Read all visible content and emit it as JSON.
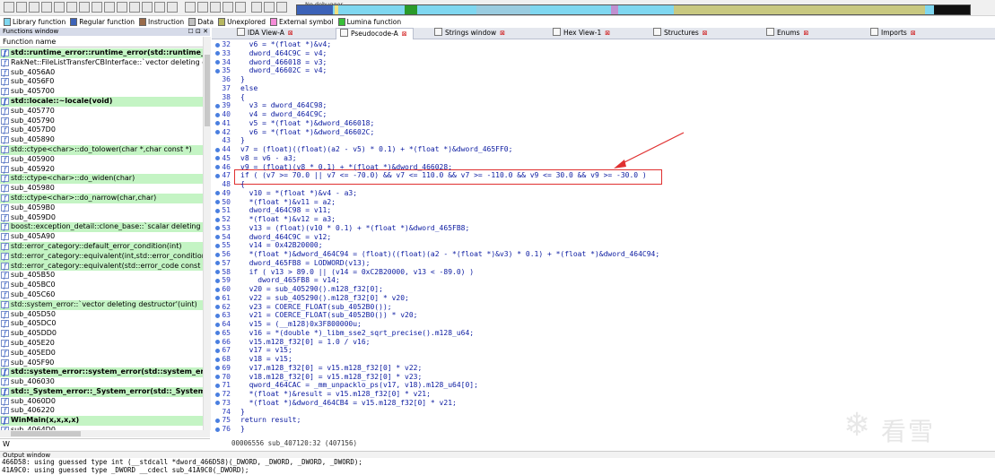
{
  "legend": [
    {
      "label": "Library function",
      "color": "#7fd7f0"
    },
    {
      "label": "Regular function",
      "color": "#3c62b8"
    },
    {
      "label": "Instruction",
      "color": "#9a6b4a"
    },
    {
      "label": "Data",
      "color": "#c0c0c0"
    },
    {
      "label": "Unexplored",
      "color": "#b8b860"
    },
    {
      "label": "External symbol",
      "color": "#f58cd8"
    },
    {
      "label": "Lumina function",
      "color": "#38c038"
    }
  ],
  "toolbar": {
    "debugger_label": "No debugger"
  },
  "functions_window": {
    "title": "Functions window",
    "column_header": "Function name",
    "filter_text": "W",
    "items": [
      {
        "name": "std::runtime_error::runtime_error(std::runtime_error c...",
        "style": "lib"
      },
      {
        "name": "RakNet::FileListTransferCBInterface::`vector deleting destr...",
        "style": "plain"
      },
      {
        "name": "sub_4056A0",
        "style": "plain"
      },
      {
        "name": "sub_4056F0",
        "style": "plain"
      },
      {
        "name": "sub_405700",
        "style": "plain"
      },
      {
        "name": "std::locale::~locale(void)",
        "style": "lib"
      },
      {
        "name": "sub_405770",
        "style": "plain"
      },
      {
        "name": "sub_405790",
        "style": "plain"
      },
      {
        "name": "sub_4057D0",
        "style": "plain"
      },
      {
        "name": "sub_405890",
        "style": "plain"
      },
      {
        "name": "std::ctype<char>::do_tolower(char *,char const *)",
        "style": "thin"
      },
      {
        "name": "sub_405900",
        "style": "plain"
      },
      {
        "name": "sub_405920",
        "style": "plain"
      },
      {
        "name": "std::ctype<char>::do_widen(char)",
        "style": "thin"
      },
      {
        "name": "sub_405980",
        "style": "plain"
      },
      {
        "name": "std::ctype<char>::do_narrow(char,char)",
        "style": "thin"
      },
      {
        "name": "sub_4059B0",
        "style": "plain"
      },
      {
        "name": "sub_4059D0",
        "style": "plain"
      },
      {
        "name": "boost::exception_detail::clone_base::`scalar deleting destr...",
        "style": "thin"
      },
      {
        "name": "sub_405A90",
        "style": "plain"
      },
      {
        "name": "std::error_category::default_error_condition(int)",
        "style": "thin"
      },
      {
        "name": "std::error_category::equivalent(int,std::error_condition co...",
        "style": "thin"
      },
      {
        "name": "std::error_category::equivalent(std::error_code const &,int)",
        "style": "thin"
      },
      {
        "name": "sub_405B50",
        "style": "plain"
      },
      {
        "name": "sub_405BC0",
        "style": "plain"
      },
      {
        "name": "sub_405C60",
        "style": "plain"
      },
      {
        "name": "std::system_error::`vector deleting destructor'(uint)",
        "style": "thin"
      },
      {
        "name": "sub_405D50",
        "style": "plain"
      },
      {
        "name": "sub_405DC0",
        "style": "plain"
      },
      {
        "name": "sub_405DD0",
        "style": "plain"
      },
      {
        "name": "sub_405E20",
        "style": "plain"
      },
      {
        "name": "sub_405ED0",
        "style": "plain"
      },
      {
        "name": "sub_405F90",
        "style": "plain"
      },
      {
        "name": "std::system_error::system_error(std::system_error con...",
        "style": "lib"
      },
      {
        "name": "sub_406030",
        "style": "plain"
      },
      {
        "name": "std::_System_error::_System_error(std::_System_error c...",
        "style": "lib"
      },
      {
        "name": "sub_4060D0",
        "style": "plain"
      },
      {
        "name": "sub_406220",
        "style": "plain"
      },
      {
        "name": "WinMain(x,x,x,x)",
        "style": "lib"
      },
      {
        "name": "sub_4064D0",
        "style": "plain"
      }
    ]
  },
  "tabs": [
    {
      "label": "IDA View-A",
      "active": false
    },
    {
      "label": "Pseudocode-A",
      "active": true
    },
    {
      "label": "Strings window",
      "active": false
    },
    {
      "label": "Hex View-1",
      "active": false
    },
    {
      "label": "Structures",
      "active": false
    },
    {
      "label": "Enums",
      "active": false
    },
    {
      "label": "Imports",
      "active": false
    }
  ],
  "code_lines": [
    {
      "n": "32",
      "text": "  v6 = *(float *)&v4;",
      "dot": true
    },
    {
      "n": "33",
      "text": "  dword_464C9C = v4;",
      "dot": true
    },
    {
      "n": "34",
      "text": "  dword_466018 = v3;",
      "dot": true
    },
    {
      "n": "35",
      "text": "  dword_46602C = v4;",
      "dot": true
    },
    {
      "n": "36",
      "text": "}",
      "dot": false
    },
    {
      "n": "37",
      "text": "else",
      "dot": false
    },
    {
      "n": "38",
      "text": "{",
      "dot": false
    },
    {
      "n": "39",
      "text": "  v3 = dword_464C98;",
      "dot": true
    },
    {
      "n": "40",
      "text": "  v4 = dword_464C9C;",
      "dot": true
    },
    {
      "n": "41",
      "text": "  v5 = *(float *)&dword_466018;",
      "dot": true
    },
    {
      "n": "42",
      "text": "  v6 = *(float *)&dword_46602C;",
      "dot": true
    },
    {
      "n": "43",
      "text": "}",
      "dot": false
    },
    {
      "n": "44",
      "text": "v7 = (float)((float)(a2 - v5) * 0.1) + *(float *)&dword_465FF0;",
      "dot": true
    },
    {
      "n": "45",
      "text": "v8 = v6 - a3;",
      "dot": true
    },
    {
      "n": "46",
      "text": "v9 = (float)(v8 * 0.1) + *(float *)&dword_466028;",
      "dot": true
    },
    {
      "n": "47",
      "text": "if ( (v7 >= 70.0 || v7 <= -70.0) && v7 <= 110.0 && v7 >= -110.0 && v9 <= 30.0 && v9 >= -30.0 )",
      "dot": true
    },
    {
      "n": "48",
      "text": "{",
      "dot": false
    },
    {
      "n": "49",
      "text": "  v10 = *(float *)&v4 - a3;",
      "dot": true
    },
    {
      "n": "50",
      "text": "  *(float *)&v11 = a2;",
      "dot": true
    },
    {
      "n": "51",
      "text": "  dword_464C98 = v11;",
      "dot": true
    },
    {
      "n": "52",
      "text": "  *(float *)&v12 = a3;",
      "dot": true
    },
    {
      "n": "53",
      "text": "  v13 = (float)(v10 * 0.1) + *(float *)&dword_465FB8;",
      "dot": true
    },
    {
      "n": "54",
      "text": "  dword_464C9C = v12;",
      "dot": true
    },
    {
      "n": "55",
      "text": "  v14 = 0x42B20000;",
      "dot": true
    },
    {
      "n": "56",
      "text": "  *(float *)&dword_464C94 = (float)((float)(a2 - *(float *)&v3) * 0.1) + *(float *)&dword_464C94;",
      "dot": true
    },
    {
      "n": "57",
      "text": "  dword_465FB8 = LODWORD(v13);",
      "dot": true
    },
    {
      "n": "58",
      "text": "  if ( v13 > 89.0 || (v14 = 0xC2B20000, v13 < -89.0) )",
      "dot": true
    },
    {
      "n": "59",
      "text": "    dword_465FB8 = v14;",
      "dot": true
    },
    {
      "n": "60",
      "text": "  v20 = sub_405290().m128_f32[0];",
      "dot": true
    },
    {
      "n": "61",
      "text": "  v22 = sub_405290().m128_f32[0] * v20;",
      "dot": true
    },
    {
      "n": "62",
      "text": "  v23 = COERCE_FLOAT(sub_4052B0());",
      "dot": true
    },
    {
      "n": "63",
      "text": "  v21 = COERCE_FLOAT(sub_4052B0()) * v20;",
      "dot": true
    },
    {
      "n": "64",
      "text": "  v15 = (__m128)0x3F800000u;",
      "dot": true
    },
    {
      "n": "65",
      "text": "  v16 = *(double *)_libm_sse2_sqrt_precise().m128_u64;",
      "dot": true
    },
    {
      "n": "66",
      "text": "  v15.m128_f32[0] = 1.0 / v16;",
      "dot": true
    },
    {
      "n": "67",
      "text": "  v17 = v15;",
      "dot": true
    },
    {
      "n": "68",
      "text": "  v18 = v15;",
      "dot": true
    },
    {
      "n": "69",
      "text": "  v17.m128_f32[0] = v15.m128_f32[0] * v22;",
      "dot": true
    },
    {
      "n": "70",
      "text": "  v18.m128_f32[0] = v15.m128_f32[0] * v23;",
      "dot": true
    },
    {
      "n": "71",
      "text": "  qword_464CAC = _mm_unpacklo_ps(v17, v18).m128_u64[0];",
      "dot": true
    },
    {
      "n": "72",
      "text": "  *(float *)&result = v15.m128_f32[0] * v21;",
      "dot": true
    },
    {
      "n": "73",
      "text": "  *(float *)&dword_464CB4 = v15.m128_f32[0] * v21;",
      "dot": true
    },
    {
      "n": "74",
      "text": "}",
      "dot": false
    },
    {
      "n": "75",
      "text": "return result;",
      "dot": true
    },
    {
      "n": "76",
      "text": "}",
      "dot": true
    }
  ],
  "status_line": "00006556 sub_407120:32 (407156)",
  "watermark_text": "看雪",
  "output_window": {
    "title": "Output window",
    "lines": [
      "466D58: using guessed type int (__stdcall *dword_466D58)(_DWORD, _DWORD, _DWORD, _DWORD);",
      "41A9C0: using guessed type _DWORD __cdecl sub_41A9C0(_DWORD);"
    ]
  }
}
